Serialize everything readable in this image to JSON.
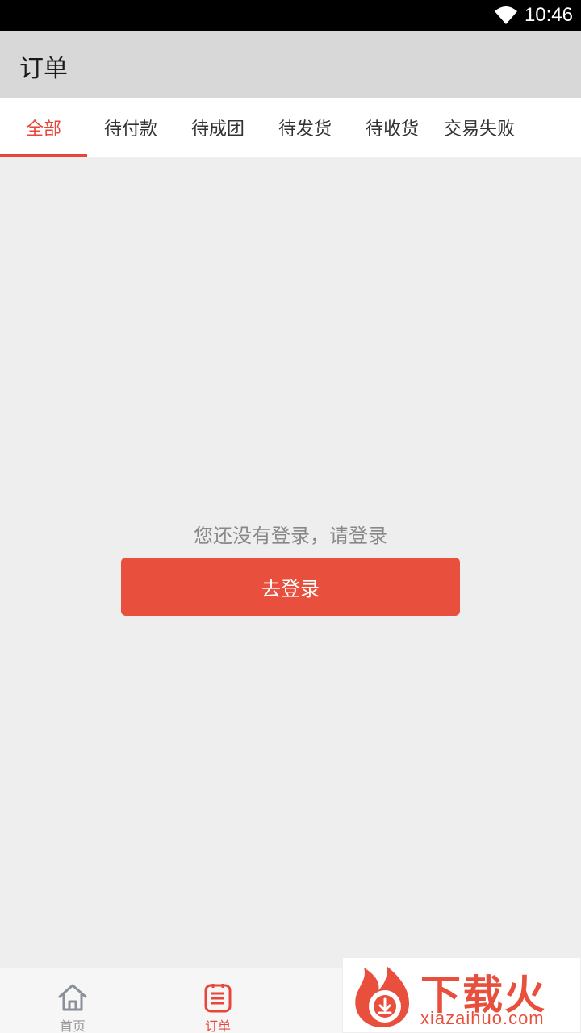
{
  "status_bar": {
    "time": "10:46"
  },
  "app_bar": {
    "title": "订单"
  },
  "tabs": [
    {
      "label": "全部",
      "active": true
    },
    {
      "label": "待付款",
      "active": false
    },
    {
      "label": "待成团",
      "active": false
    },
    {
      "label": "待发货",
      "active": false
    },
    {
      "label": "待收货",
      "active": false
    },
    {
      "label": "交易失败",
      "active": false
    }
  ],
  "empty_state": {
    "message": "您还没有登录，请登录",
    "button_label": "去登录"
  },
  "bottom_nav": {
    "items": [
      {
        "label": "首页",
        "icon": "home-icon",
        "active": false
      },
      {
        "label": "订单",
        "icon": "order-list-icon",
        "active": true
      }
    ]
  },
  "watermark": {
    "brand": "下载火",
    "domain": "xiazaihuo.com"
  },
  "colors": {
    "accent": "#e8463a",
    "button": "#e84f3c",
    "app_bar": "#d8d8d8",
    "background": "#eeeeee"
  }
}
